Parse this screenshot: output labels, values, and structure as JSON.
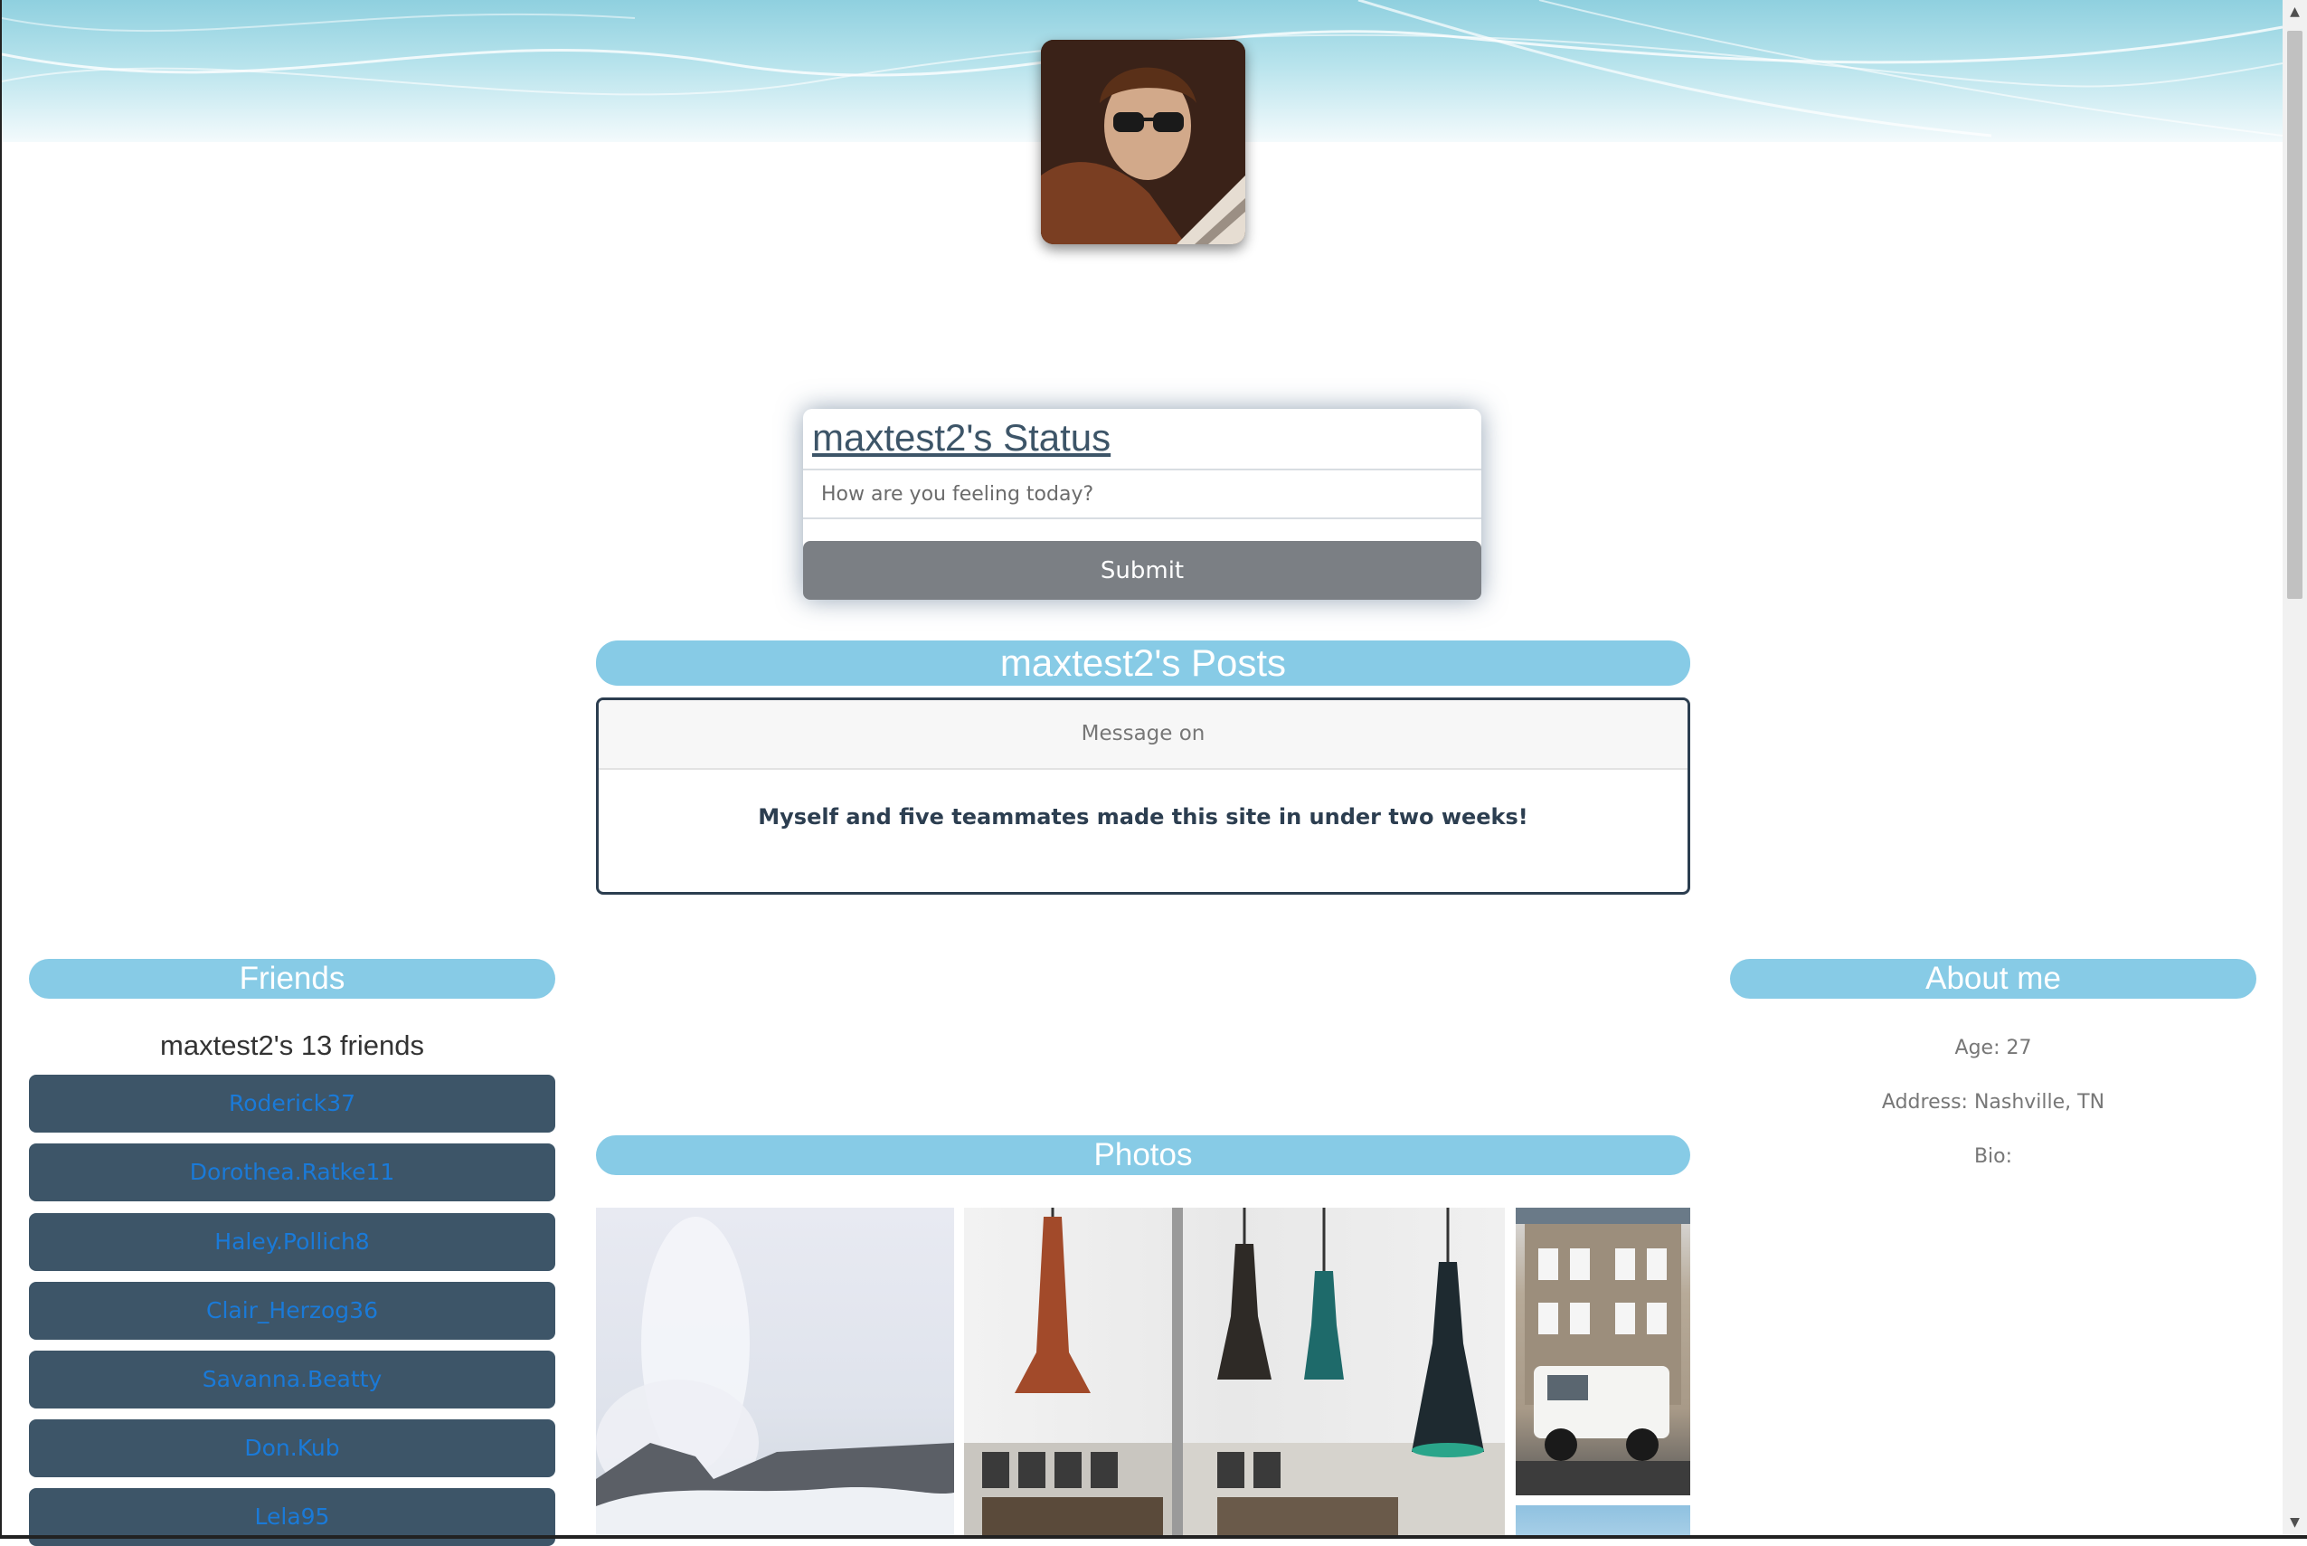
{
  "profile": {
    "avatar_alt": "Profile photo"
  },
  "status": {
    "title": "maxtest2's Status",
    "input_placeholder": "How are you feeling today?",
    "submit_label": "Submit"
  },
  "posts": {
    "heading": "maxtest2's Posts",
    "items": [
      {
        "header": "Message on",
        "body": "Myself and five teammates made this site in under two weeks!"
      }
    ]
  },
  "friends": {
    "heading": "Friends",
    "count_label": "maxtest2's 13 friends",
    "items": [
      "Roderick37",
      "Dorothea.Ratke11",
      "Haley.Pollich8",
      "Clair_Herzog36",
      "Savanna.Beatty",
      "Don.Kub",
      "Lela95"
    ]
  },
  "about": {
    "heading": "About me",
    "age": "Age: 27",
    "address": "Address: Nashville, TN",
    "bio": "Bio:"
  },
  "photos": {
    "heading": "Photos",
    "items": [
      "geyser-landscape",
      "hanging-lamps",
      "house-with-jeep",
      "sky"
    ]
  },
  "colors": {
    "accent": "#87cbe6",
    "friend_button": "#3d5568",
    "friend_link": "#1a7ad8",
    "submit_button": "#7b7f84",
    "post_border": "#2c3e50"
  }
}
